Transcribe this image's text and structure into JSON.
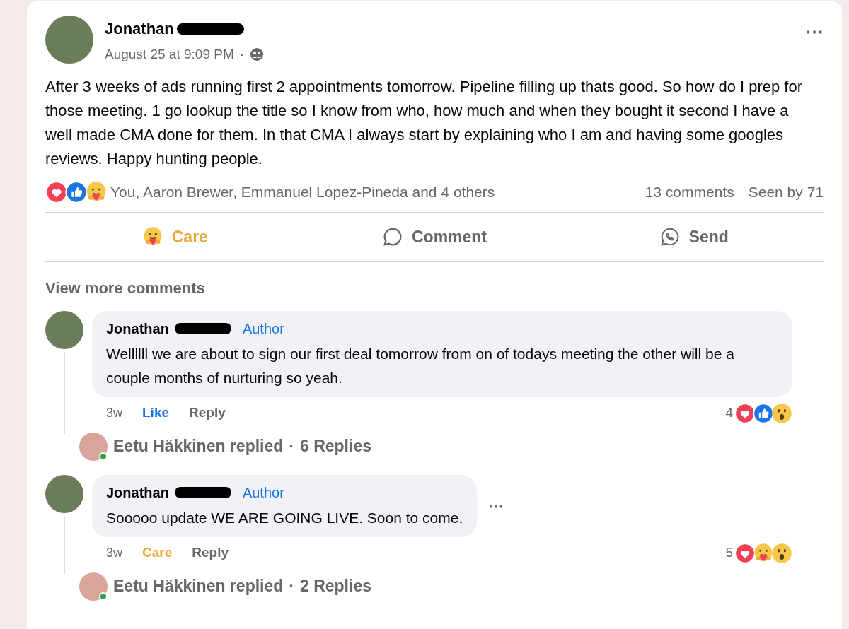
{
  "post": {
    "author": "Jonathan",
    "timestamp": "August 25 at 9:09 PM",
    "separator": "·",
    "more_menu": "⋯",
    "text": "After 3 weeks of ads running first 2 appointments tomorrow. Pipeline filling up thats good. So how do I prep for those meeting. 1 go lookup the title so I know from who, how much  and when they bought it second I have a well made CMA done for them. In that CMA I always start by explaining who I am and having some googles reviews. Happy hunting people.",
    "reactions": [
      {
        "kind": "love"
      },
      {
        "kind": "like"
      },
      {
        "kind": "care"
      }
    ],
    "reactors": "You, Aaron Brewer, Emmanuel Lopez-Pineda and 4 others",
    "comments_count": "13 comments",
    "seen_by": "Seen by 71",
    "actions": [
      {
        "label": "Care",
        "kind": "care",
        "selected": true
      },
      {
        "label": "Comment",
        "kind": "comment",
        "selected": false
      },
      {
        "label": "Send",
        "kind": "send",
        "selected": false
      }
    ]
  },
  "view_more": "View more comments",
  "comments": [
    {
      "author": "Jonathan",
      "badge": "Author",
      "text": "Wellllll we are about to sign our first deal tomorrow from on of todays meeting the other will be a couple months of nurturing so yeah.",
      "time": "3w",
      "reaction_action": {
        "label": "Like",
        "kind": "like",
        "selected": true
      },
      "reply_label": "Reply",
      "reaction_count": "4",
      "reactions": [
        {
          "kind": "love"
        },
        {
          "kind": "like"
        },
        {
          "kind": "wow"
        }
      ],
      "replies": {
        "name": "Eetu Häkkinen replied",
        "separator": "·",
        "count": "6 Replies",
        "online": true
      }
    },
    {
      "author": "Jonathan",
      "badge": "Author",
      "text": "Sooooo update WE ARE GOING LIVE. Soon to come.",
      "more_menu": "⋯",
      "time": "3w",
      "reaction_action": {
        "label": "Care",
        "kind": "care",
        "selected": true
      },
      "reply_label": "Reply",
      "reaction_count": "5",
      "reactions": [
        {
          "kind": "love"
        },
        {
          "kind": "care"
        },
        {
          "kind": "wow"
        }
      ],
      "replies": {
        "name": "Eetu Häkkinen replied",
        "separator": "·",
        "count": "2 Replies",
        "online": true
      }
    }
  ]
}
